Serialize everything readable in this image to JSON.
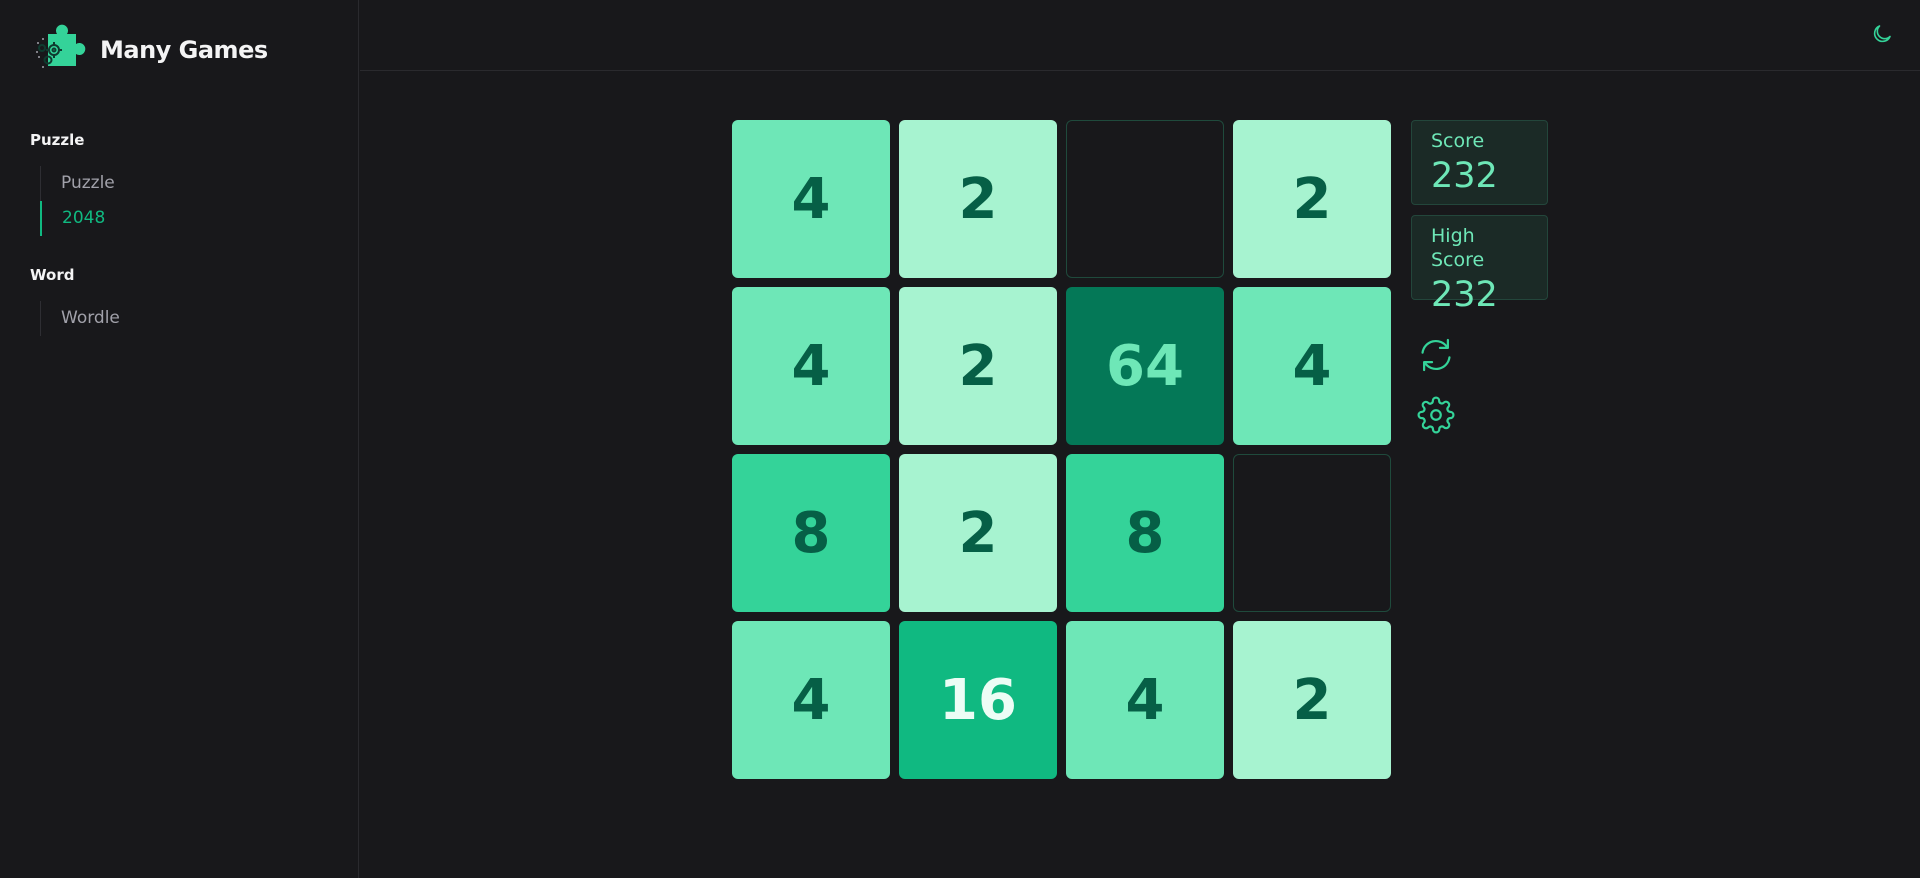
{
  "brand": {
    "title": "Many Games",
    "logo_icon": "puzzle-gears-icon"
  },
  "sidebar": {
    "sections": [
      {
        "title": "Puzzle",
        "items": [
          {
            "label": "Puzzle",
            "active": false
          },
          {
            "label": "2048",
            "active": true
          }
        ]
      },
      {
        "title": "Word",
        "items": [
          {
            "label": "Wordle",
            "active": false
          }
        ]
      }
    ]
  },
  "header": {
    "theme_toggle_icon": "moon-icon"
  },
  "board": {
    "rows": [
      [
        "4",
        "2",
        "",
        "2"
      ],
      [
        "4",
        "2",
        "64",
        "4"
      ],
      [
        "8",
        "2",
        "8",
        ""
      ],
      [
        "4",
        "16",
        "4",
        "2"
      ]
    ]
  },
  "score": {
    "label": "Score",
    "value": "232"
  },
  "high_score": {
    "label": "High Score",
    "value": "232"
  },
  "controls": {
    "restart_icon": "refresh-icon",
    "settings_icon": "gear-icon"
  },
  "colors": {
    "accent": "#10b981",
    "background": "#18181b",
    "tile_2": "#a7f3d0",
    "tile_4": "#6ee7b7",
    "tile_8": "#34d399",
    "tile_16": "#10b981",
    "tile_64": "#047857"
  }
}
